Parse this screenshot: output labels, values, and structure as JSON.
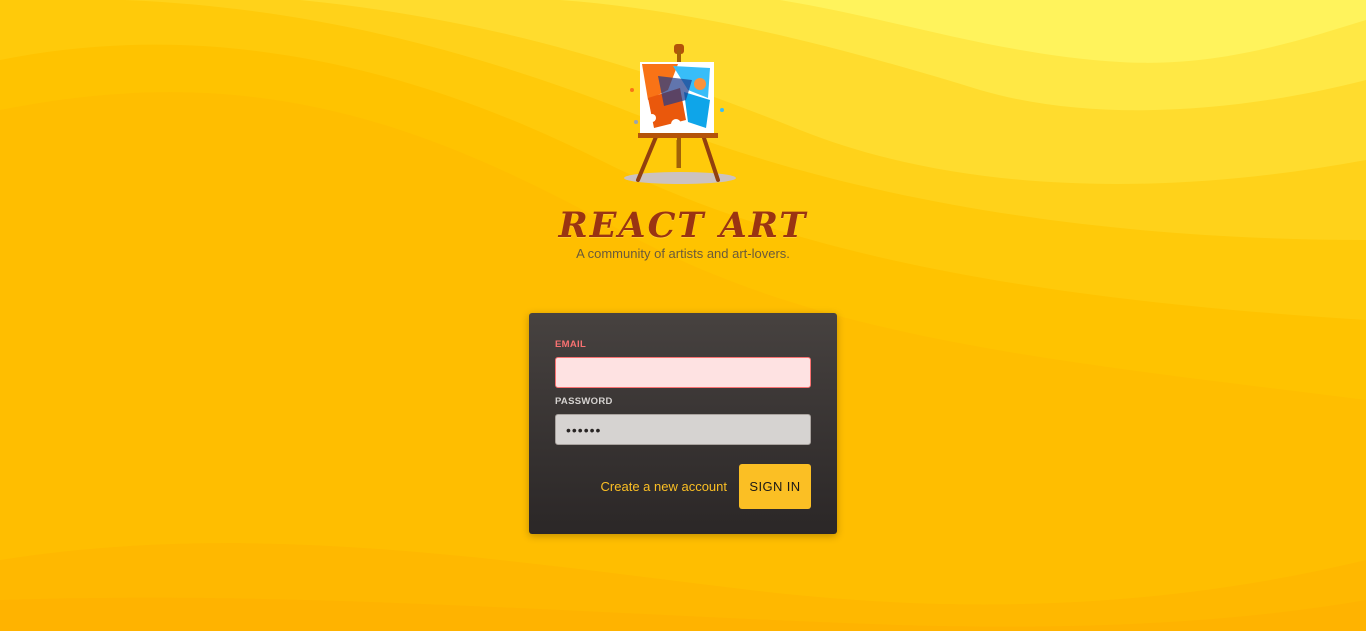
{
  "header": {
    "title": "REACT ART",
    "subtitle": "A community of artists and art-lovers.",
    "logo_icon": "easel-painting-icon"
  },
  "colors": {
    "background": "#ffc107",
    "title": "#9a3412",
    "card": "#2b2727",
    "accent": "#fbbf24",
    "error_label": "#f87171",
    "error_input_bg": "#fee2e2"
  },
  "form": {
    "email": {
      "label": "EMAIL",
      "value": "",
      "invalid": true
    },
    "password": {
      "label": "PASSWORD",
      "value": "••••••"
    },
    "create_account_label": "Create a new account",
    "signin_label": "SIGN IN"
  }
}
